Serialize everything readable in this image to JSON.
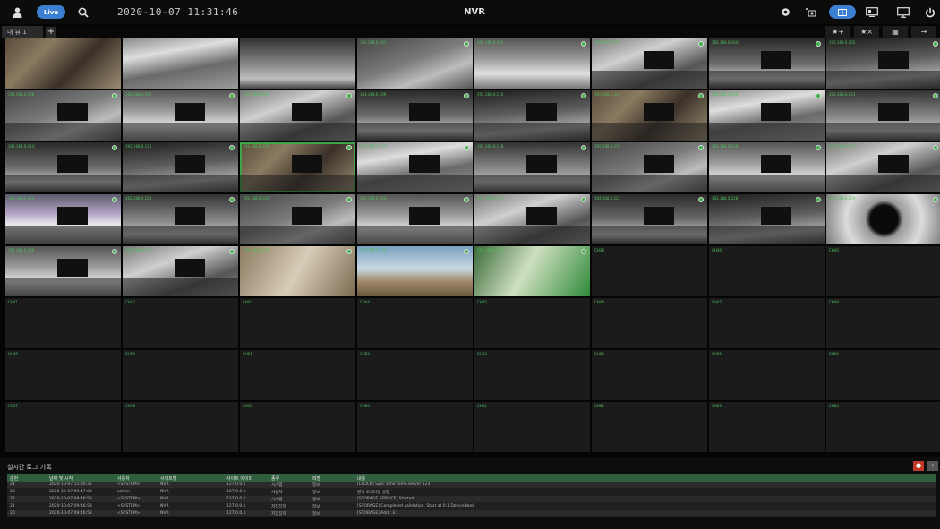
{
  "topbar": {
    "live_label": "Live",
    "datetime": "2020-10-07 11:31:46",
    "title": "NVR"
  },
  "tabs": {
    "active_tab": "내 뷰 1",
    "add_label": "+",
    "tools": [
      "★+",
      "★×",
      "▦",
      "→"
    ]
  },
  "cameras": {
    "labels": [
      "",
      "",
      "",
      "192.168.0.101",
      "192.168.0.102",
      "192.168.0.103",
      "192.168.0.104",
      "192.168.0.105",
      "192.168.0.106",
      "192.168.0.107",
      "192.168.0.108",
      "192.168.0.109",
      "192.168.0.110",
      "192.168.0.111",
      "192.168.0.112",
      "192.168.0.113",
      "192.168.0.114",
      "192.168.0.115",
      "192.168.0.116",
      "192.168.0.117",
      "192.168.0.118",
      "192.168.0.119",
      "192.168.0.120",
      "192.168.0.121",
      "192.168.0.122",
      "192.168.0.123",
      "192.168.0.124",
      "192.168.0.125",
      "192.168.0.126",
      "192.168.0.127",
      "192.168.0.128",
      "192.168.0.129",
      "192.168.0.130",
      "192.168.0.131",
      "192.168.0.132",
      "192.168.0.133",
      "192.168.0.134",
      "CH38",
      "CH39",
      "CH40",
      "CH41",
      "CH42",
      "CH43",
      "CH44",
      "CH45",
      "CH46",
      "CH47",
      "CH48",
      "CH49",
      "CH50",
      "CH51",
      "CH52",
      "CH53",
      "CH54",
      "CH55",
      "CH56",
      "CH57",
      "CH58",
      "CH59",
      "CH60",
      "CH61",
      "CH62",
      "CH63",
      "CH64"
    ],
    "active_count": 37,
    "selected_index": 18
  },
  "log": {
    "title": "실시간 로그 기록",
    "columns": [
      "순번",
      "날짜 및 시작",
      "사용자",
      "사이트명",
      "사이트 아이피",
      "종류",
      "레벨",
      "내용"
    ],
    "rows": [
      [
        "24",
        "2020-10-07 11:30:35",
        "<SYSTEM>",
        "NVR",
        "127.0.0.1",
        "시스템",
        "정보",
        "[CLOCK] Sync time: time.server 123"
      ],
      [
        "23",
        "2020-10-07 09:47:03",
        "admin",
        "NVR",
        "127.0.0.1",
        "사용자",
        "정보",
        "원격 모니터링 실행"
      ],
      [
        "22",
        "2020-10-07 09:46:53",
        "<SYSTEM>",
        "NVR",
        "127.0.0.1",
        "시스템",
        "정보",
        "[STORAGE SERVICE] Started"
      ],
      [
        "21",
        "2020-10-07 09:46:53",
        "<SYSTEM>",
        "NVR",
        "127.0.0.1",
        "저장장치",
        "정보",
        "[STORAGE] Completed validation. Start at 0.1 DeviceBank"
      ],
      [
        "20",
        "2020-10-07 09:46:53",
        "<SYSTEM>",
        "NVR",
        "127.0.0.1",
        "저장장치",
        "정보",
        "[STORAGE] Add : E:\\"
      ]
    ]
  },
  "colors": {
    "accent": "#3a7fd0",
    "status_green": "#3fb44a",
    "header_green": "#2f5f3e",
    "record_red": "#c0392b"
  }
}
